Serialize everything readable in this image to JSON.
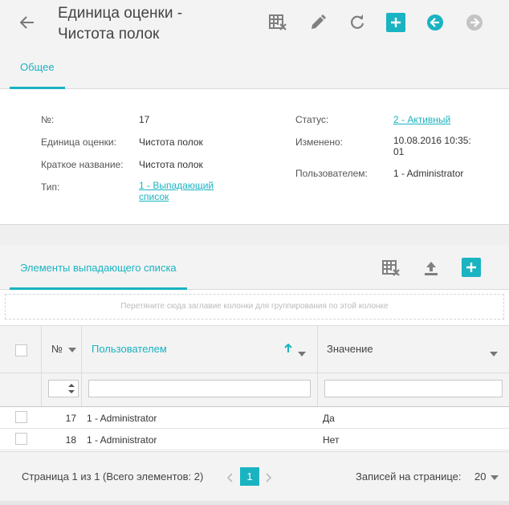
{
  "header": {
    "title_line1": "Единица оценки -",
    "title_line2": "Чистота полок"
  },
  "tabs": [
    {
      "label": "Общее"
    }
  ],
  "details": {
    "number_label": "№:",
    "number_value": "17",
    "unit_label": "Единица оценки:",
    "unit_value": "Чистота полок",
    "short_name_label": "Краткое название:",
    "short_name_value": "Чистота полок",
    "type_label": "Тип:",
    "type_value_line1": "1 - Выпадающий",
    "type_value_line2": "список",
    "status_label": "Статус:",
    "status_value": "2 - Активный",
    "changed_label": "Изменено:",
    "changed_value_line1": "10.08.2016 10:35:",
    "changed_value_line2": "01",
    "user_label": "Пользователем:",
    "user_value": "1 - Administrator"
  },
  "list_section": {
    "tab_label": "Элементы выпадающего списка",
    "group_hint": "Перетяните сюда заглавие колонки для группирования по этой колонке",
    "columns": {
      "number": "№",
      "user": "Пользователем",
      "value": "Значение"
    },
    "rows": [
      {
        "number": "17",
        "user": "1 - Administrator",
        "value": "Да"
      },
      {
        "number": "18",
        "user": "1 - Administrator",
        "value": "Нет"
      }
    ],
    "pager": {
      "summary": "Страница 1 из 1 (Всего элементов: 2)",
      "current_page": "1",
      "page_size_label": "Записей на странице:",
      "page_size_value": "20"
    }
  },
  "colors": {
    "accent": "#1ab3c2",
    "icon_gray": "#7f7f7f"
  }
}
